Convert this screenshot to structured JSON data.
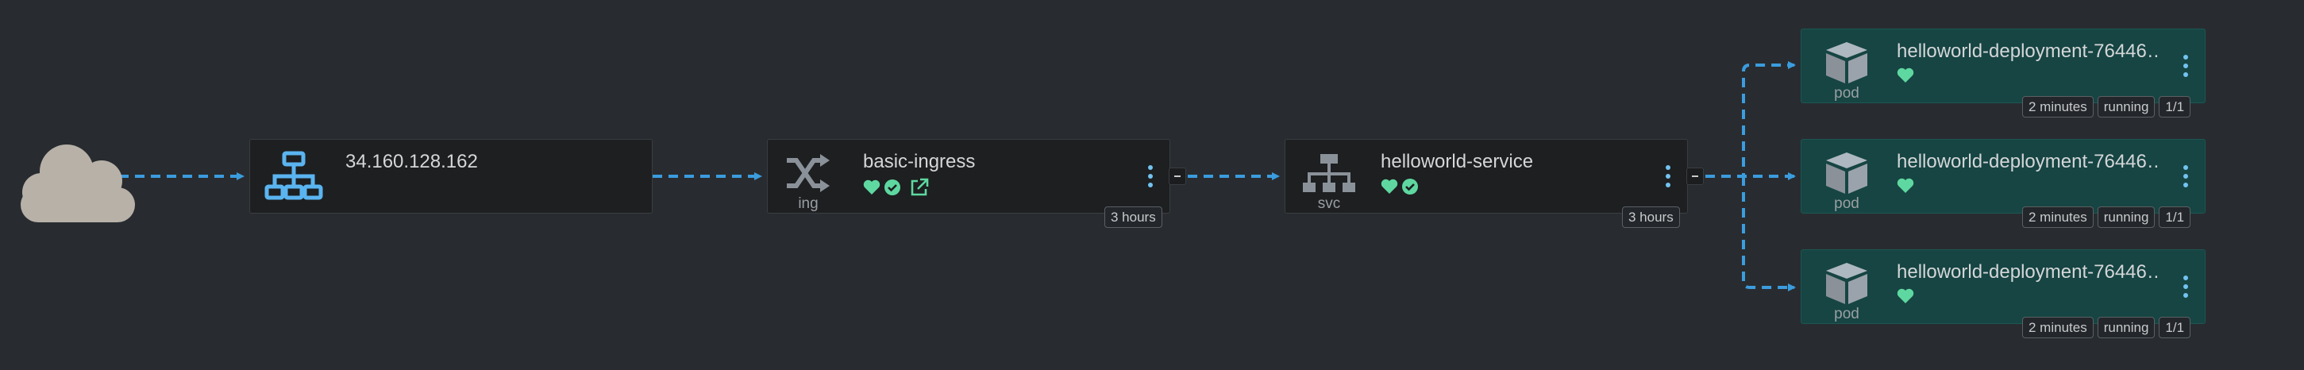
{
  "colors": {
    "background": "#282c30",
    "edge": "#3b9cde",
    "status_green": "#5ed8a0",
    "icon_blue": "#5ab4f0",
    "icon_gray": "#8a9199",
    "pod_bg": "#164543"
  },
  "internet": {
    "icon": "cloud-icon"
  },
  "load_balancer": {
    "icon": "network-icon",
    "address": "34.160.128.162"
  },
  "ingress": {
    "icon": "shuffle-icon",
    "kind": "ing",
    "name": "basic-ingress",
    "status_icons": [
      "heart-icon",
      "check-circle-icon",
      "external-link-icon"
    ],
    "age": "3 hours"
  },
  "service": {
    "icon": "hierarchy-icon",
    "kind": "svc",
    "name": "helloworld-service",
    "status_icons": [
      "heart-icon",
      "check-circle-icon"
    ],
    "age": "3 hours"
  },
  "pods": [
    {
      "icon": "cube-icon",
      "kind": "pod",
      "name": "helloworld-deployment-76446…",
      "age": "2 minutes",
      "state": "running",
      "ready": "1/1"
    },
    {
      "icon": "cube-icon",
      "kind": "pod",
      "name": "helloworld-deployment-76446…",
      "age": "2 minutes",
      "state": "running",
      "ready": "1/1"
    },
    {
      "icon": "cube-icon",
      "kind": "pod",
      "name": "helloworld-deployment-76446…",
      "age": "2 minutes",
      "state": "running",
      "ready": "1/1"
    }
  ]
}
